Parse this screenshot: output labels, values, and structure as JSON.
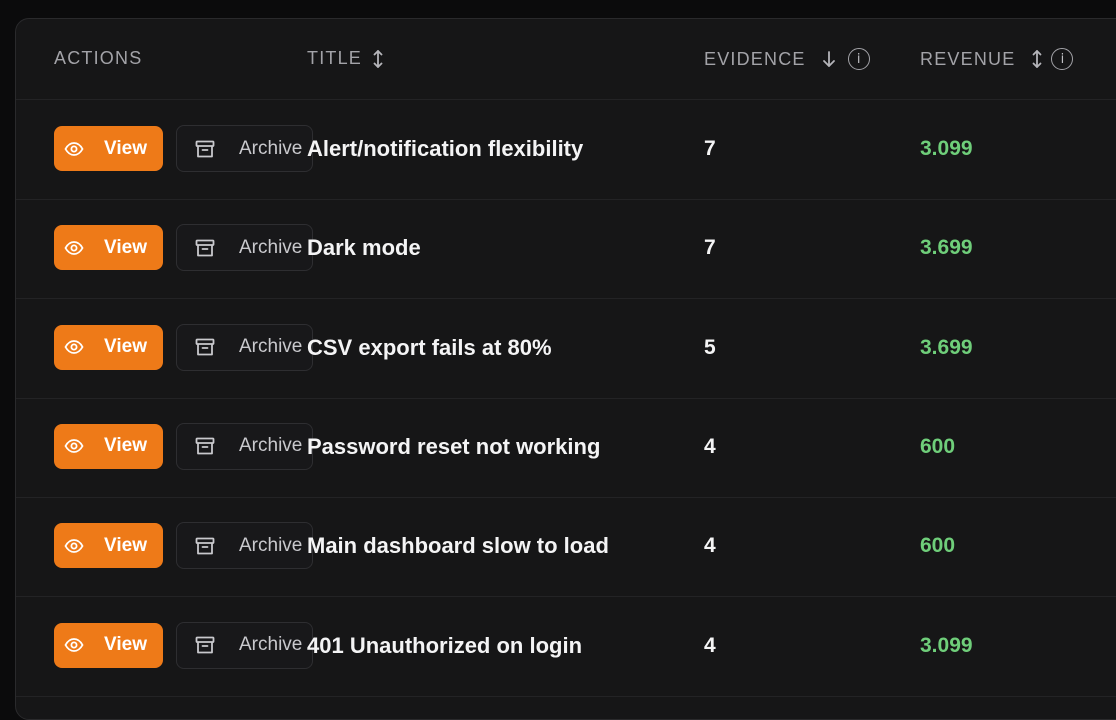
{
  "header": {
    "actions": "ACTIONS",
    "title": "TITLE",
    "evidence": "EVIDENCE",
    "revenue": "REVENUE",
    "info_glyph": "i"
  },
  "colors": {
    "accent": "#ee7a18",
    "revenue": "#6fce7a",
    "background": "#161617"
  },
  "actions": {
    "view_label": "View",
    "archive_label": "Archive",
    "view_icon": "eye-icon",
    "archive_icon": "archive-box-icon"
  },
  "rows": [
    {
      "title": "Alert/notification flexibility",
      "evidence": "7",
      "revenue": "3.099"
    },
    {
      "title": "Dark mode",
      "evidence": "7",
      "revenue": "3.699"
    },
    {
      "title": "CSV export fails at 80%",
      "evidence": "5",
      "revenue": "3.699"
    },
    {
      "title": "Password reset not working",
      "evidence": "4",
      "revenue": "600"
    },
    {
      "title": "Main dashboard slow to load",
      "evidence": "4",
      "revenue": "600"
    },
    {
      "title": "401 Unauthorized on login",
      "evidence": "4",
      "revenue": "3.099"
    }
  ]
}
